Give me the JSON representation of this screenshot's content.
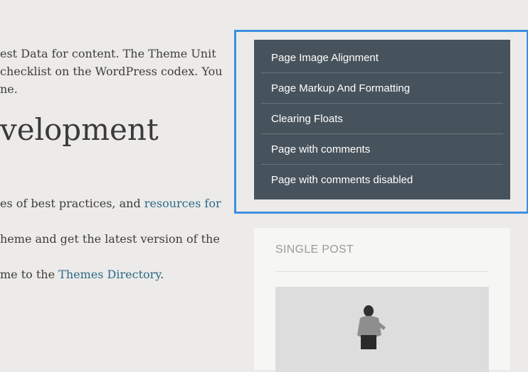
{
  "content": {
    "line1": "est Data for content. The Theme Unit",
    "line2": "checklist on the WordPress codex. You",
    "line3": "ne.",
    "heading": "velopment",
    "line4_text": "es of best practices, and ",
    "line4_link": "resources for",
    "line5": "heme and get the latest version of the",
    "line6_text": "me to the ",
    "line6_link": "Themes Directory",
    "line6_end": "."
  },
  "menu": {
    "items": [
      {
        "label": "Page Image Alignment"
      },
      {
        "label": "Page Markup And Formatting"
      },
      {
        "label": "Clearing Floats"
      },
      {
        "label": "Page with comments"
      },
      {
        "label": "Page with comments disabled"
      }
    ]
  },
  "single_post": {
    "title": "SINGLE POST"
  },
  "colors": {
    "focus": "#3d8fe0",
    "menu_bg": "#47535c",
    "link": "#2d6a87"
  }
}
